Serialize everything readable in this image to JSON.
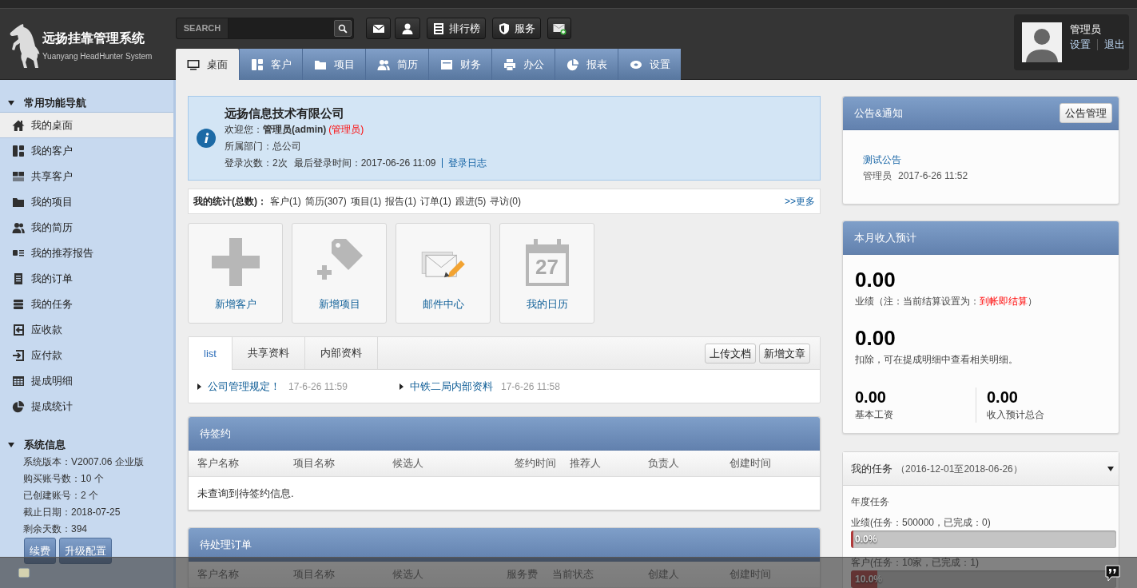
{
  "header": {
    "logo": {
      "title": "远扬挂靠管理系统",
      "subtitle": "Yuanyang HeadHunter System"
    },
    "search": {
      "label": "SEARCH"
    },
    "toolbar": [
      {
        "label": "排行榜"
      },
      {
        "label": "服务"
      }
    ],
    "user": {
      "name": "管理员",
      "links": [
        "设置",
        "退出"
      ]
    }
  },
  "nav": {
    "tabs": [
      {
        "label": "桌面",
        "selected": true
      },
      {
        "label": "客户",
        "selected": false
      },
      {
        "label": "项目",
        "selected": false
      },
      {
        "label": "简历",
        "selected": false
      },
      {
        "label": "财务",
        "selected": false
      },
      {
        "label": "办公",
        "selected": false
      },
      {
        "label": "报表",
        "selected": false
      },
      {
        "label": "设置",
        "selected": false
      }
    ]
  },
  "sidebar": {
    "nav": {
      "title": "常用功能导航",
      "expanded": true,
      "items": [
        {
          "label": "我的桌面",
          "selected": true
        },
        {
          "label": "我的客户",
          "selected": false
        },
        {
          "label": "共享客户",
          "selected": false
        },
        {
          "label": "我的项目",
          "selected": false
        },
        {
          "label": "我的简历",
          "selected": false
        },
        {
          "label": "我的推荐报告",
          "selected": false
        },
        {
          "label": "我的订单",
          "selected": false
        },
        {
          "label": "我的任务",
          "selected": false
        },
        {
          "label": "应收款",
          "selected": false
        },
        {
          "label": "应付款",
          "selected": false
        },
        {
          "label": "提成明细",
          "selected": false
        },
        {
          "label": "提成统计",
          "selected": false
        }
      ]
    },
    "system": {
      "title": "系统信息",
      "expanded": true,
      "lines": [
        "系统版本：V2007.06 企业版",
        "购买账号数：10 个",
        "已创建账号：2 个",
        "截止日期：2018-07-25",
        "剩余天数：394"
      ],
      "buttons": [
        "续费",
        "升级配置"
      ]
    }
  },
  "welcome": {
    "company": "远扬信息技术有限公司",
    "greeting": "欢迎您：**管理员(admin)**",
    "role": "(管理员)",
    "department": "所属部门：总公司",
    "login_count": "登录次数：2次",
    "last_login": "最后登录时间：2017-06-26 11:09",
    "log_link": "登录日志"
  },
  "stats": {
    "title": "我的统计(总数)：",
    "items": [
      "客户(1)",
      "简历(307)",
      "项目(1)",
      "报告(1)",
      "订单(1)",
      "跟进(5)",
      "寻访(0)"
    ],
    "more": ">>更多"
  },
  "quick_actions": [
    {
      "label": "新增客户"
    },
    {
      "label": "新增项目"
    },
    {
      "label": "邮件中心"
    },
    {
      "label": "我的日历",
      "icon_text": "27"
    }
  ],
  "documents": {
    "tabs": [
      {
        "label": "list",
        "selected": true
      },
      {
        "label": "共享资料",
        "selected": false
      },
      {
        "label": "内部资料",
        "selected": false
      }
    ],
    "buttons": [
      "上传文档",
      "新增文章"
    ],
    "items": [
      {
        "title": "公司管理规定！",
        "date": "17-6-26 11:59"
      },
      {
        "title": "中铁二局内部资料",
        "date": "17-6-26 11:58"
      }
    ]
  },
  "pending_contracts": {
    "title": "待签约",
    "columns": [
      "客户名称",
      "项目名称",
      "候选人",
      "签约时间",
      "推荐人",
      "负责人",
      "创建时间"
    ],
    "empty": "未查询到待签约信息."
  },
  "pending_orders": {
    "title": "待处理订单",
    "columns": [
      "客户名称",
      "项目名称",
      "候选人",
      "服务费",
      "当前状态",
      "创建人",
      "创建时间"
    ]
  },
  "announcements": {
    "title": "公告&通知",
    "button": "公告管理",
    "items": [
      {
        "title": "测试公告",
        "author": "管理员",
        "date": "2017-6-26 11:52"
      }
    ]
  },
  "income": {
    "title": "本月收入预计",
    "figures": [
      {
        "value": "0.00",
        "caption": "业绩（注：当前结算设置为：",
        "highlight": "到帐即结算",
        "caption_end": "）"
      },
      {
        "value": "0.00",
        "caption": "扣除，可在提成明细中查看相关明细。"
      }
    ],
    "totals": [
      {
        "value": "0.00",
        "caption": "基本工资"
      },
      {
        "value": "0.00",
        "caption": "收入预计总合"
      }
    ]
  },
  "tasks": {
    "title": "我的任务",
    "range": "（2016-12-01至2018-06-26）",
    "expanded": true,
    "section": "年度任务",
    "goals": [
      {
        "label": "业绩(任务：500000，已完成：0)",
        "level": 0,
        "reading": "0.0%"
      },
      {
        "label": "客户(任务：10家，已完成：1)",
        "level": 0.1,
        "reading": "10.0%"
      }
    ]
  }
}
